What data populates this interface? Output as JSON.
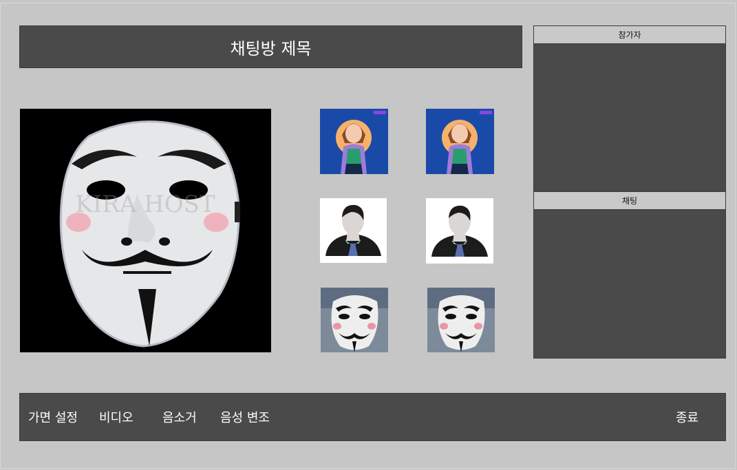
{
  "header": {
    "title": "채팅방 제목"
  },
  "main_video": {
    "avatar": "guy-fawkes-mask",
    "watermark": "KIRA HOST"
  },
  "participants_grid": [
    {
      "avatar": "zepeto-girl-avatar"
    },
    {
      "avatar": "zepeto-girl-avatar"
    },
    {
      "avatar": "default-person-avatar"
    },
    {
      "avatar": "default-person-avatar"
    },
    {
      "avatar": "guy-fawkes-mask-person"
    },
    {
      "avatar": "guy-fawkes-mask-person"
    }
  ],
  "sidebar": {
    "participants_label": "참가자",
    "chat_label": "채팅"
  },
  "toolbar": {
    "mask_settings": "가면 설정",
    "video": "비디오",
    "mute": "음소거",
    "voice_modulation": "음성 변조",
    "exit": "종료"
  },
  "colors": {
    "background": "#c6c6c6",
    "panel": "#4a4a4a",
    "header_light": "#c9c9c9"
  }
}
